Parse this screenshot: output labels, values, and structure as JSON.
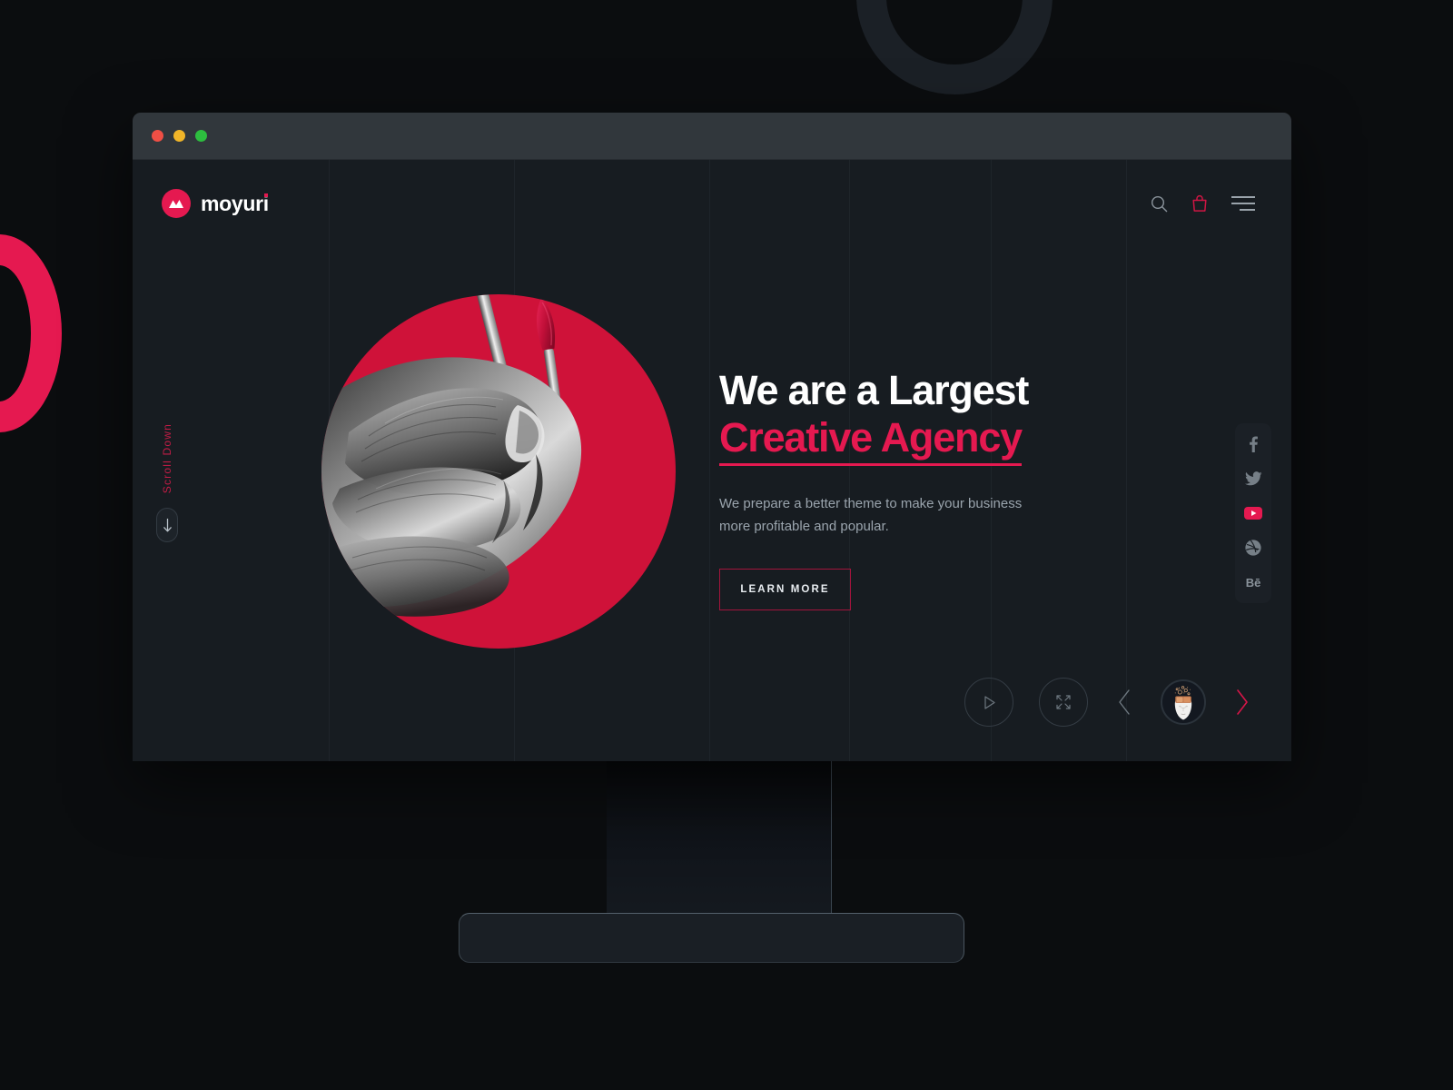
{
  "theme": {
    "accent": "#e51950",
    "accent_deep": "#cf1239",
    "page_bg": "#171c21",
    "scene_bg": "#0b0d0f",
    "titlebar_bg": "#31373c",
    "muted_text": "#9aa4ad"
  },
  "window": {
    "traffic_lights": [
      {
        "name": "close",
        "color": "#ef4f45"
      },
      {
        "name": "minimize",
        "color": "#f0b529"
      },
      {
        "name": "maximize",
        "color": "#2dbe3f"
      }
    ]
  },
  "header": {
    "brand": "moyuri",
    "brand_icon": "mountain-logo-icon",
    "tools": [
      {
        "name": "search-icon",
        "label": "Search"
      },
      {
        "name": "shopping-bag-icon",
        "label": "Cart"
      },
      {
        "name": "hamburger-menu-icon",
        "label": "Menu"
      }
    ]
  },
  "scroll": {
    "label": "Scroll Down",
    "arrow_icon": "arrow-down-icon"
  },
  "hero": {
    "title_line1": "We are a Largest",
    "title_line2": "Creative Agency",
    "paragraph": "We prepare a better theme to make your business more profitable and popular.",
    "cta_label": "LEARN MORE",
    "visual_alt": "hand-holding-paintbrushes-on-crimson-circle"
  },
  "social": [
    {
      "name": "facebook-icon",
      "label": "f",
      "color": "#767f87",
      "active": false
    },
    {
      "name": "twitter-icon",
      "label": "t",
      "color": "#767f87",
      "active": false
    },
    {
      "name": "youtube-icon",
      "label": "yt",
      "color": "#e51950",
      "active": true
    },
    {
      "name": "dribbble-icon",
      "label": "d",
      "color": "#767f87",
      "active": false
    },
    {
      "name": "behance-icon",
      "label": "Bē",
      "color": "#8a939b",
      "active": false
    }
  ],
  "controls": [
    {
      "name": "play-button",
      "icon": "play-icon",
      "label": "Play"
    },
    {
      "name": "expand-button",
      "icon": "expand-icon",
      "label": "Expand"
    },
    {
      "name": "prev-slide-button",
      "icon": "chevron-left-icon",
      "label": "Previous"
    },
    {
      "name": "slide-thumbnail",
      "icon": "head-ideas-thumbnail",
      "label": "Slide thumbnail"
    },
    {
      "name": "next-slide-button",
      "icon": "chevron-right-icon",
      "label": "Next"
    }
  ],
  "decor": {
    "ring_dark_color": "#1b2026",
    "ring_pink_color": "#e51950"
  },
  "grid_lines": [
    216,
    420,
    635,
    789,
    945,
    1094
  ]
}
